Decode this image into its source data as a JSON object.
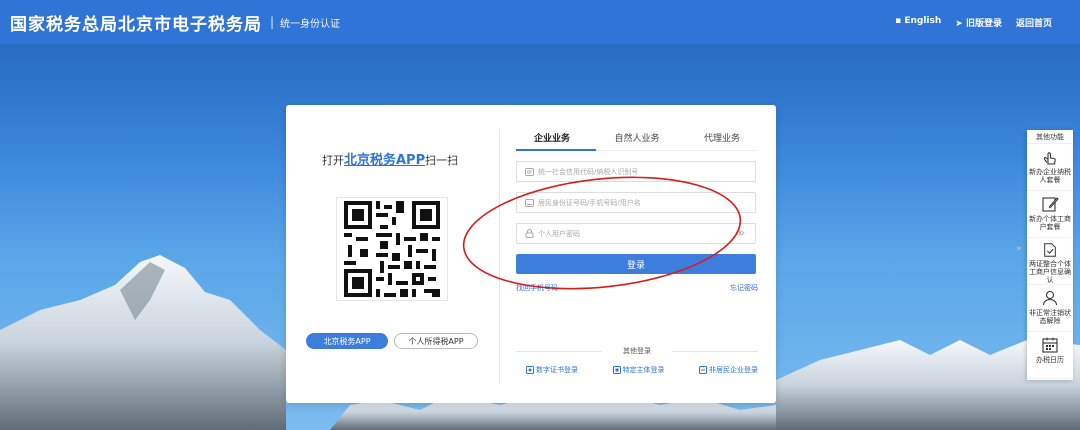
{
  "header": {
    "title": "国家税务总局北京市电子税务局",
    "separator": "|",
    "subtitle": "统一身份认证",
    "links": {
      "english": "English",
      "old_version": "旧版登录",
      "home": "返回首页"
    }
  },
  "left_panel": {
    "scan_prefix": "打开",
    "scan_app": "北京税务APP",
    "scan_suffix": "扫一扫",
    "btn_beijing_app": "北京税务APP",
    "btn_personal_tax_app": "个人所得税APP"
  },
  "tabs": [
    {
      "label": "企业业务",
      "active": true
    },
    {
      "label": "自然人业务",
      "active": false
    },
    {
      "label": "代理业务",
      "active": false
    }
  ],
  "form": {
    "field1_placeholder": "统一社会信用代码/纳税人识别号",
    "field2_placeholder": "居民身份证号码/手机号码/用户名",
    "field3_placeholder": "个人用户密码",
    "login_button": "登录",
    "link_forgot_phone": "找回手机号码",
    "link_forgot_password": "忘记密码"
  },
  "other_login": {
    "title": "其他登录",
    "links": [
      "数字证书登录",
      "特定主体登录",
      "非居民企业登录"
    ]
  },
  "side_panel": {
    "title": "其他功能",
    "items": [
      "新办企业纳税人套餐",
      "新办个体工商户套餐",
      "两证整合个体工商户信息确认",
      "非正常注销状态解除",
      "办税日历"
    ]
  },
  "colors": {
    "primary": "#3d7ddb",
    "header": "#2f74d6",
    "annotation": "#d91c1c"
  }
}
